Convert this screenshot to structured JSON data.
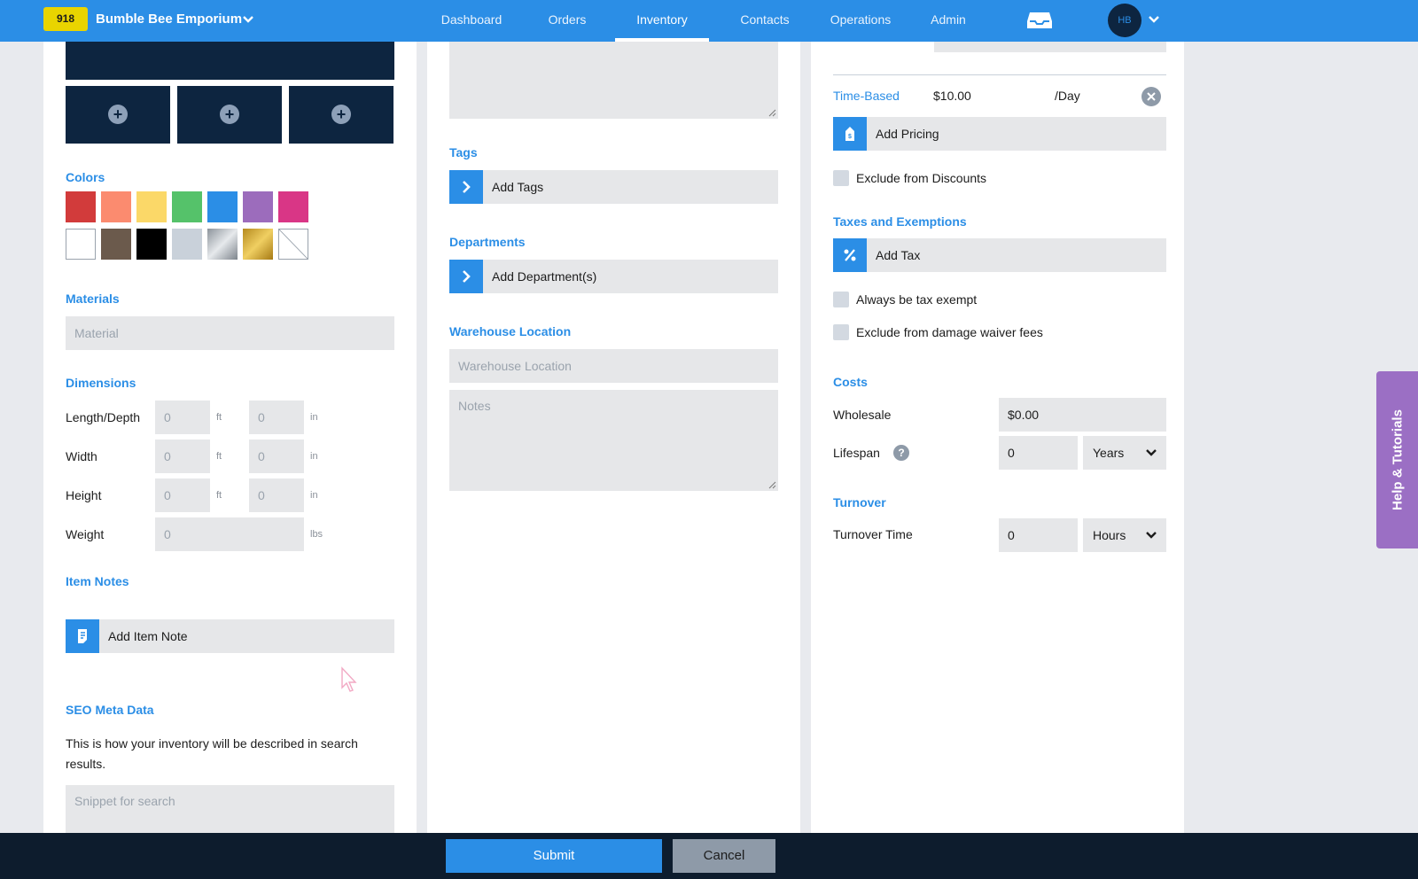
{
  "topbar": {
    "store_badge": "918",
    "store_name": "Bumble Bee Emporium",
    "nav": [
      "Dashboard",
      "Orders",
      "Inventory",
      "Contacts",
      "Operations",
      "Admin"
    ],
    "active_nav": "Inventory",
    "avatar_initials": "HB",
    "color": "#2b8ee6"
  },
  "left": {
    "colors_title": "Colors",
    "swatches_row1": [
      "#d23b3b",
      "#fb8b6f",
      "#fbd868",
      "#55c26a",
      "#2b8ee6",
      "#9c6cbc",
      "#d93686"
    ],
    "swatches_row2": [
      "#ffffff",
      "#6b5a4c",
      "#000000",
      "#c9d1da",
      "silver-gradient",
      "gold-gradient",
      "none"
    ],
    "materials_title": "Materials",
    "material_placeholder": "Material",
    "dimensions_title": "Dimensions",
    "dims": [
      {
        "label": "Length/Depth",
        "v1": "0",
        "u1": "ft",
        "v2": "0",
        "u2": "in"
      },
      {
        "label": "Width",
        "v1": "0",
        "u1": "ft",
        "v2": "0",
        "u2": "in"
      },
      {
        "label": "Height",
        "v1": "0",
        "u1": "ft",
        "v2": "0",
        "u2": "in"
      }
    ],
    "weight_label": "Weight",
    "weight_value": "0",
    "weight_unit": "lbs",
    "item_notes_title": "Item Notes",
    "add_item_note": "Add Item Note",
    "seo_title": "SEO Meta Data",
    "seo_desc": "This is how your inventory will be described in search results.",
    "seo_placeholder": "Snippet for search"
  },
  "middle": {
    "tags_title": "Tags",
    "add_tags": "Add Tags",
    "departments_title": "Departments",
    "add_departments": "Add Department(s)",
    "warehouse_title": "Warehouse Location",
    "warehouse_placeholder": "Warehouse Location",
    "notes_placeholder": "Notes"
  },
  "right": {
    "pricing": {
      "type": "Time-Based",
      "amount": "$10.00",
      "period": "/Day"
    },
    "add_pricing": "Add Pricing",
    "exclude_discounts": "Exclude from Discounts",
    "taxes_title": "Taxes and Exemptions",
    "add_tax": "Add Tax",
    "always_tax_exempt": "Always be tax exempt",
    "exclude_damage_waiver": "Exclude from damage waiver fees",
    "costs_title": "Costs",
    "wholesale_label": "Wholesale",
    "wholesale_value": "$0.00",
    "lifespan_label": "Lifespan",
    "lifespan_value": "0",
    "lifespan_unit": "Years",
    "turnover_title": "Turnover",
    "turnover_label": "Turnover Time",
    "turnover_value": "0",
    "turnover_unit": "Hours"
  },
  "help_tab": "Help & Tutorials",
  "footer": {
    "submit": "Submit",
    "cancel": "Cancel"
  }
}
